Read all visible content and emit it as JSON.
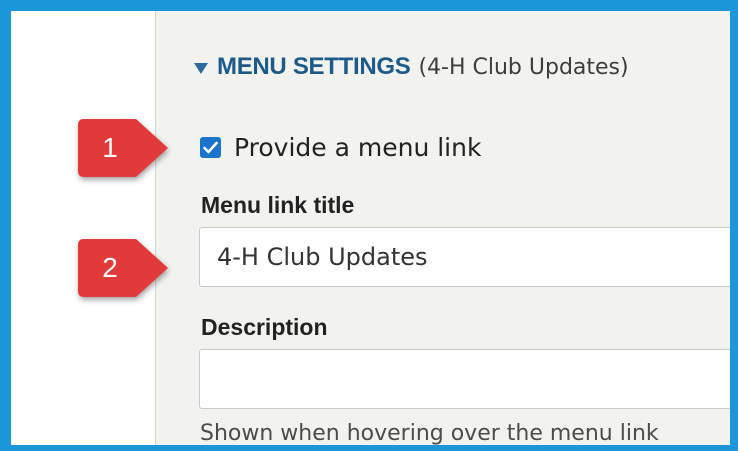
{
  "menu_settings": {
    "title": "MENU SETTINGS",
    "subtitle": "(4-H Club Updates)",
    "expanded": true
  },
  "provide_menu_link": {
    "label": "Provide a menu link",
    "checked": true
  },
  "menu_link_title": {
    "label": "Menu link title",
    "value": "4-H Club Updates"
  },
  "description": {
    "label": "Description",
    "value": "",
    "help_text": "Shown when hovering over the menu link"
  },
  "callouts": [
    {
      "number": "1"
    },
    {
      "number": "2"
    }
  ],
  "colors": {
    "frame_border": "#1b96d8",
    "callout_red": "#e23a3a",
    "summary_title": "#1d5a8c",
    "checkbox_blue": "#1a74c9",
    "panel_bg": "#f2f2ef"
  },
  "icons": {
    "summary_toggle": "triangle-down-icon",
    "checkbox_mark": "checkmark-icon"
  }
}
